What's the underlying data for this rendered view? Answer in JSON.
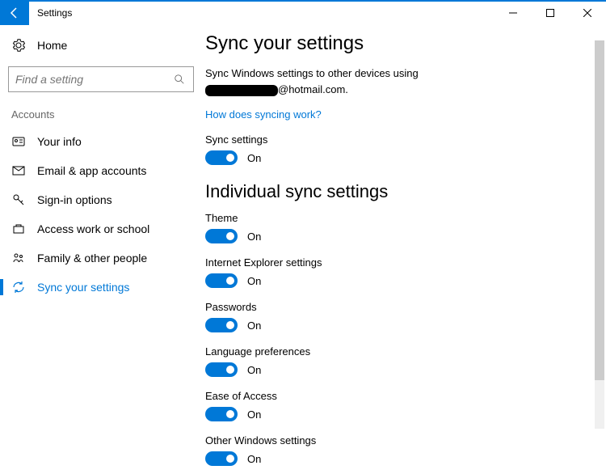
{
  "window": {
    "title": "Settings"
  },
  "sidebar": {
    "home": "Home",
    "search_placeholder": "Find a setting",
    "section": "Accounts",
    "items": [
      {
        "label": "Your info"
      },
      {
        "label": "Email & app accounts"
      },
      {
        "label": "Sign-in options"
      },
      {
        "label": "Access work or school"
      },
      {
        "label": "Family & other people"
      },
      {
        "label": "Sync your settings"
      }
    ]
  },
  "main": {
    "heading": "Sync your settings",
    "desc_line1": "Sync Windows settings to other devices using",
    "desc_email_suffix": "@hotmail.com.",
    "help_link": "How does syncing work?",
    "sync_label": "Sync settings",
    "on_text": "On",
    "individual_heading": "Individual sync settings",
    "settings": [
      {
        "label": "Theme"
      },
      {
        "label": "Internet Explorer settings"
      },
      {
        "label": "Passwords"
      },
      {
        "label": "Language preferences"
      },
      {
        "label": "Ease of Access"
      },
      {
        "label": "Other Windows settings"
      }
    ]
  }
}
